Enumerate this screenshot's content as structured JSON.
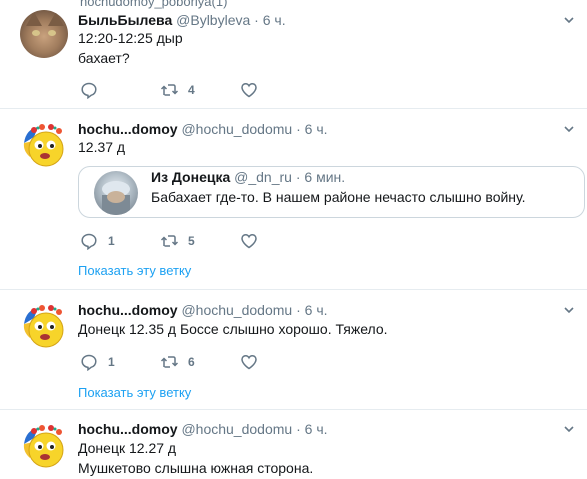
{
  "top_cut_text": "nochudomoy_poboriya(1)",
  "tweets": [
    {
      "name": "БыльБылева",
      "handle": "@Bylbyleva",
      "dot": "·",
      "time": "6 ч.",
      "lines": [
        "12:20-12:25 дыр",
        "бахает?"
      ],
      "reply_count": "",
      "retweet_count": "4",
      "like_count": ""
    },
    {
      "name": "hochu...domoy",
      "handle": "@hochu_dodomu",
      "dot": "·",
      "time": "6 ч.",
      "lines": [
        "12.37 д"
      ],
      "quote": {
        "name": "Из Донецка",
        "handle": "@_dn_ru",
        "dot": "·",
        "time": "6 мин.",
        "text": "Бабахает где-то. В нашем районе нечасто слышно войну."
      },
      "reply_count": "1",
      "retweet_count": "5",
      "like_count": "",
      "thread_link": "Показать эту ветку"
    },
    {
      "name": "hochu...domoy",
      "handle": "@hochu_dodomu",
      "dot": "·",
      "time": "6 ч.",
      "lines": [
        "Донецк 12.35 д Боссе слышно хорошо. Тяжело."
      ],
      "reply_count": "1",
      "retweet_count": "6",
      "like_count": "",
      "thread_link": "Показать эту ветку"
    },
    {
      "name": "hochu...domoy",
      "handle": "@hochu_dodomu",
      "dot": "·",
      "time": "6 ч.",
      "lines": [
        "Донецк 12.27 д",
        "Мушкетово слышна южная сторона."
      ]
    }
  ],
  "colors": {
    "accent": "#1da1f2",
    "secondary_text": "#657786",
    "border": "#e6ecf0"
  },
  "icons": {
    "reply": "reply-icon",
    "retweet": "retweet-icon",
    "like": "heart-icon",
    "more": "chevron-down-icon"
  }
}
